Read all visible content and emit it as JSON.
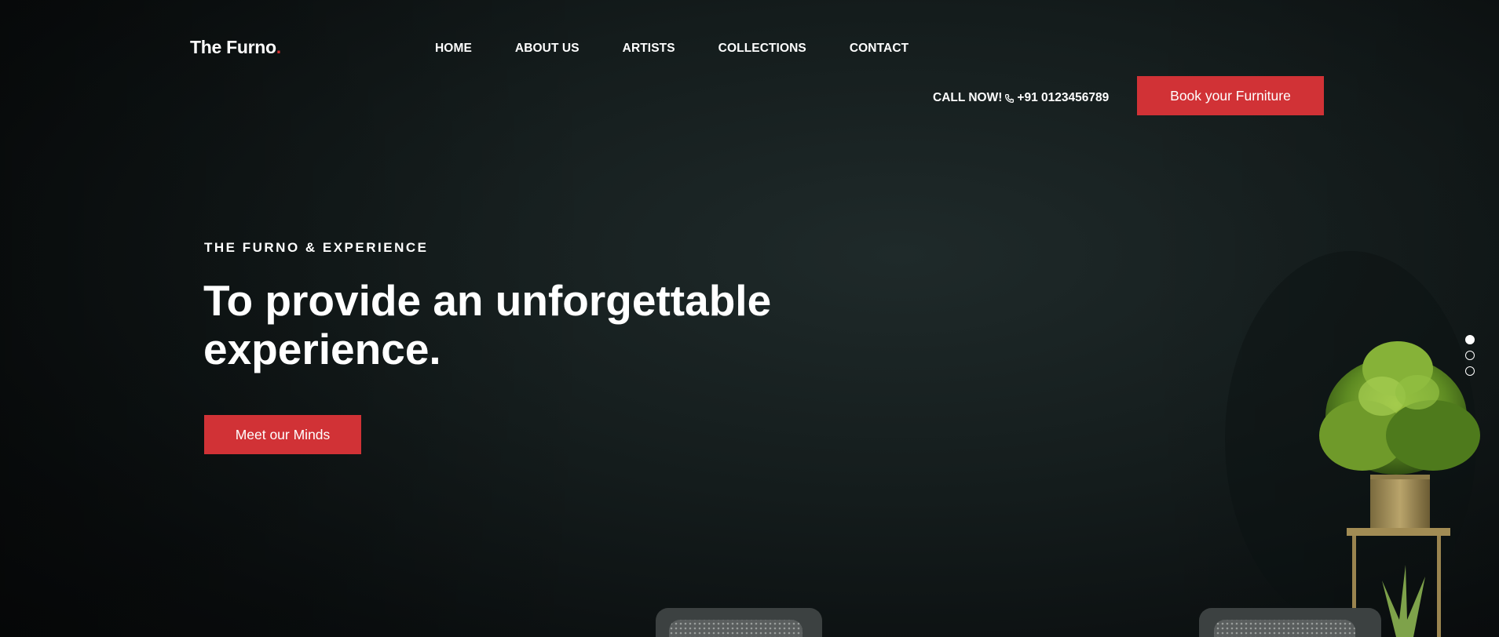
{
  "brand": {
    "name": "The Furno",
    "dot": ".",
    "accent_color": "#d32f2f"
  },
  "nav": {
    "items": [
      {
        "label": "HOME"
      },
      {
        "label": "ABOUT US"
      },
      {
        "label": "ARTISTS"
      },
      {
        "label": "COLLECTIONS"
      },
      {
        "label": "CONTACT"
      }
    ]
  },
  "header": {
    "call_label": "CALL NOW!",
    "phone_icon": "phone-icon",
    "phone": "+91 0123456789",
    "book_button": "Book your Furniture"
  },
  "hero": {
    "eyebrow": "THE FURNO & EXPERIENCE",
    "headline_line1": "To provide an unforgettable",
    "headline_line2": "experience.",
    "cta": "Meet our Minds"
  },
  "slider": {
    "count": 3,
    "active_index": 0
  }
}
